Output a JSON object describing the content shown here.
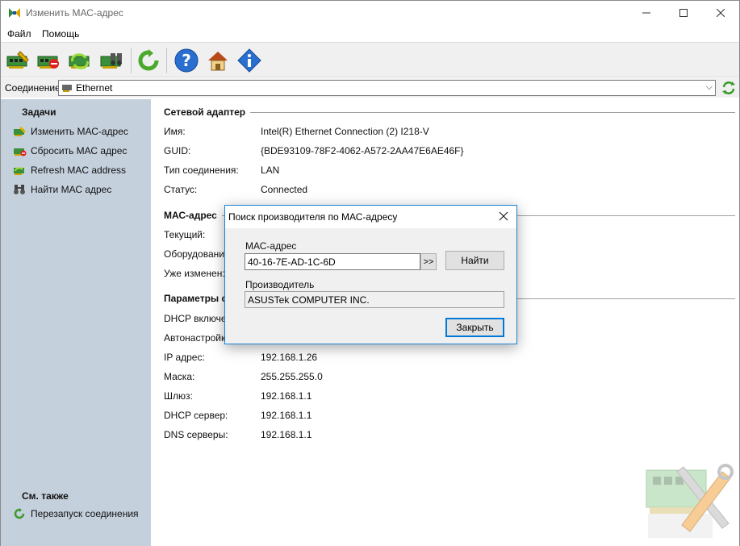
{
  "window": {
    "title": "Изменить МАС-адрес"
  },
  "menu": {
    "file": "Файл",
    "help": "Помощь"
  },
  "connection": {
    "label": "Соединение:",
    "value": "Ethernet"
  },
  "sidebar": {
    "tasks_heading": "Задачи",
    "tasks": [
      {
        "label": "Изменить МАС-адрес",
        "icon": "card-edit-icon"
      },
      {
        "label": "Сбросить МАС адрес",
        "icon": "card-reset-icon"
      },
      {
        "label": "Refresh MAC address",
        "icon": "card-refresh-icon"
      },
      {
        "label": "Найти МАС адрес",
        "icon": "binoculars-icon"
      }
    ],
    "see_also_heading": "См. также",
    "see_also": [
      {
        "label": "Перезапуск соединения",
        "icon": "restart-icon"
      }
    ]
  },
  "adapter": {
    "title": "Сетевой адаптер",
    "rows": [
      {
        "label": "Имя:",
        "value": "Intel(R) Ethernet Connection (2) I218-V"
      },
      {
        "label": "GUID:",
        "value": "{BDE93109-78F2-4062-A572-2AA47E6AE46F}"
      },
      {
        "label": "Тип соединения:",
        "value": "LAN"
      },
      {
        "label": "Статус:",
        "value": "Connected"
      }
    ]
  },
  "mac": {
    "title": "МАС-адрес",
    "rows": [
      {
        "label": "Текущий:"
      },
      {
        "label": "Оборудование:"
      },
      {
        "label": "Уже изменен:"
      }
    ]
  },
  "params": {
    "title": "Параметры с",
    "rows": [
      {
        "label": "DHCP включен",
        "value": ""
      },
      {
        "label": "Автонастройка",
        "value": ""
      },
      {
        "label": "IP адрес:",
        "value": "192.168.1.26"
      },
      {
        "label": "Маска:",
        "value": "255.255.255.0"
      },
      {
        "label": "Шлюз:",
        "value": "192.168.1.1"
      },
      {
        "label": "DHCP сервер:",
        "value": "192.168.1.1"
      },
      {
        "label": "DNS серверы:",
        "value": "192.168.1.1"
      }
    ]
  },
  "dialog": {
    "title": "Поиск производителя по МАС-адресу",
    "mac_label": "МАС-адрес",
    "mac_value": "40-16-7E-AD-1C-6D",
    "arrow_label": ">>",
    "find_label": "Найти",
    "vendor_label": "Производитель",
    "vendor_value": "ASUSTek COMPUTER INC.",
    "close_label": "Закрыть"
  },
  "colors": {
    "sidebar_bg": "#c5d0dd",
    "accent": "#0078d7"
  }
}
